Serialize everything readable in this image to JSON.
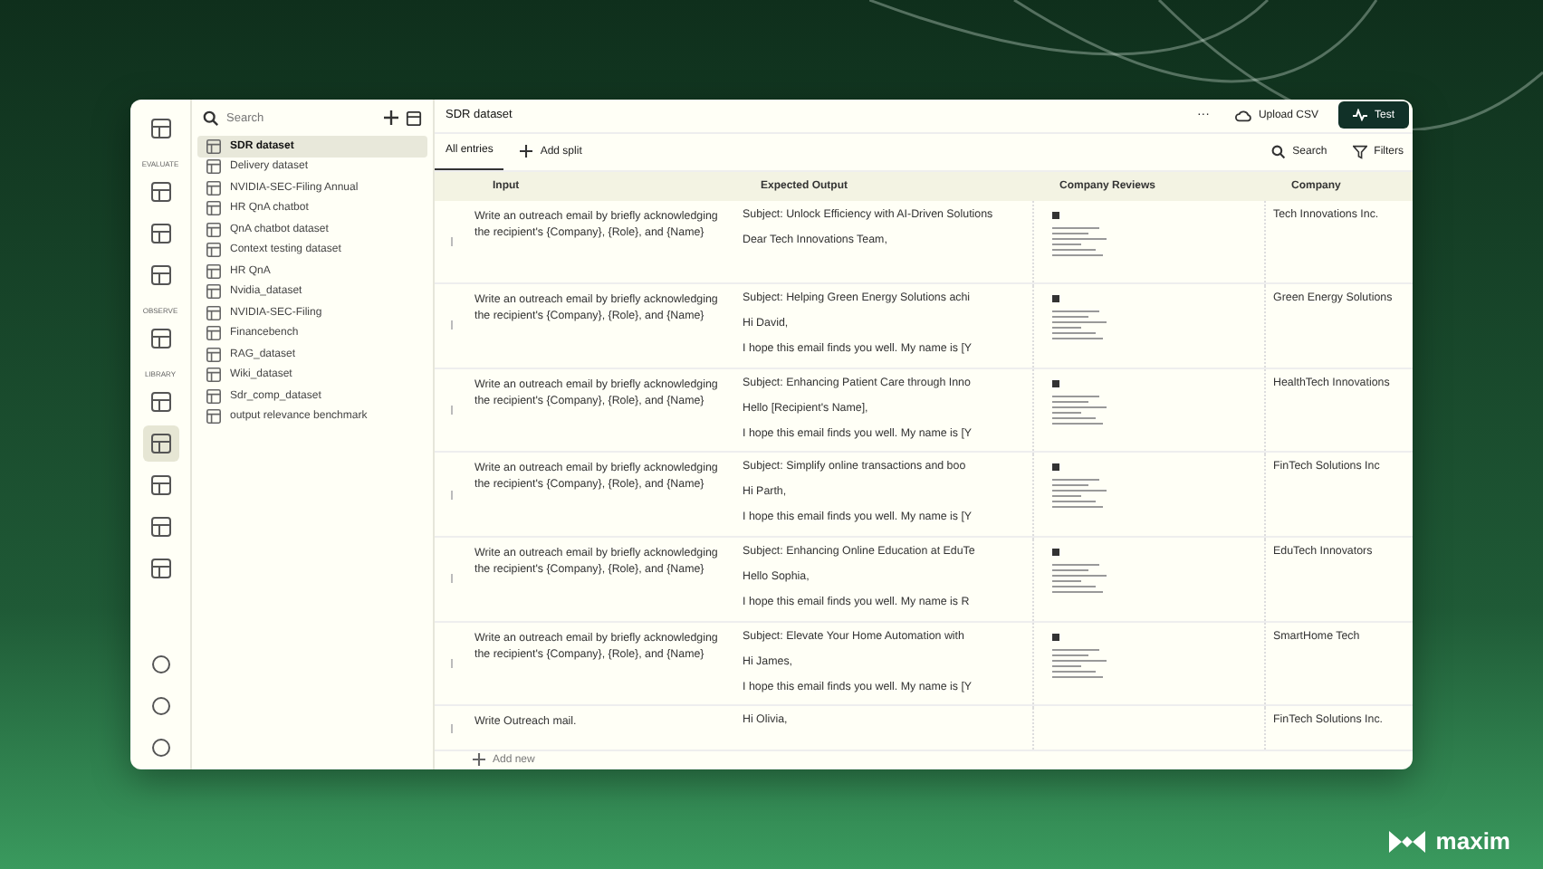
{
  "rail": [
    {
      "kind": "icon",
      "selected": false
    },
    {
      "kind": "label",
      "text": "EVALUATE"
    },
    {
      "kind": "icon",
      "selected": false
    },
    {
      "kind": "icon",
      "selected": false
    },
    {
      "kind": "icon",
      "selected": false
    },
    {
      "kind": "label",
      "text": "OBSERVE"
    },
    {
      "kind": "icon",
      "selected": false
    },
    {
      "kind": "label",
      "text": "LIBRARY"
    },
    {
      "kind": "icon",
      "selected": false
    },
    {
      "kind": "icon",
      "selected": true
    },
    {
      "kind": "icon",
      "selected": false
    },
    {
      "kind": "icon",
      "selected": false
    },
    {
      "kind": "icon",
      "selected": false
    }
  ],
  "rail_bottom": [
    {
      "kind": "icon",
      "selected": false
    },
    {
      "kind": "icon",
      "selected": false
    },
    {
      "kind": "icon",
      "selected": false
    }
  ],
  "sidebar": {
    "search": {
      "placeholder": "Search"
    },
    "items": [
      {
        "label": "SDR dataset",
        "selected": true
      },
      {
        "label": "Delivery dataset",
        "selected": false
      },
      {
        "label": "NVIDIA-SEC-Filing Annual",
        "selected": false
      },
      {
        "label": "HR QnA chatbot",
        "selected": false
      },
      {
        "label": "QnA chatbot dataset",
        "selected": false
      },
      {
        "label": "Context testing dataset",
        "selected": false
      },
      {
        "label": "HR QnA",
        "selected": false
      },
      {
        "label": "Nvidia_dataset",
        "selected": false
      },
      {
        "label": "NVIDIA-SEC-Filing",
        "selected": false
      },
      {
        "label": "Financebench",
        "selected": false
      },
      {
        "label": "RAG_dataset",
        "selected": false
      },
      {
        "label": "Wiki_dataset",
        "selected": false
      },
      {
        "label": "Sdr_comp_dataset",
        "selected": false
      },
      {
        "label": "output relevance benchmark",
        "selected": false
      }
    ]
  },
  "main": {
    "title": "SDR dataset",
    "more": "···",
    "upload": "Upload CSV",
    "test": "Test",
    "tabs": [
      {
        "label": "All entries",
        "selected": true
      }
    ],
    "add_split": "Add split",
    "search": "Search",
    "filters": "Filters",
    "columns": [
      "Input",
      "Expected Output",
      "Company Reviews",
      "Company"
    ],
    "rows": [
      {
        "input": "Write an outreach email by briefly acknowledging the recipient's {Company}, {Role}, and {Name}",
        "expected_output": [
          "Subject: Unlock Efficiency with AI-Driven Solutions",
          "Dear Tech Innovations Team,"
        ],
        "company": "Tech Innovations Inc.",
        "has_review": true
      },
      {
        "input": "Write an outreach email by briefly acknowledging the recipient's {Company}, {Role}, and {Name}",
        "expected_output": [
          "Subject: Helping Green Energy Solutions achi",
          "Hi David,",
          "I hope this email finds you well. My name is [Y"
        ],
        "company": "Green Energy Solutions",
        "has_review": true
      },
      {
        "input": "Write an outreach email by briefly acknowledging the recipient's {Company}, {Role}, and {Name}",
        "expected_output": [
          "Subject: Enhancing Patient Care through Inno",
          "Hello [Recipient's Name],",
          "I hope this email finds you well. My name is [Y"
        ],
        "company": "HealthTech Innovations",
        "has_review": true
      },
      {
        "input": "Write an outreach email by briefly acknowledging the recipient's {Company}, {Role}, and {Name}",
        "expected_output": [
          "Subject: Simplify online transactions and boo",
          "Hi Parth,",
          "I hope this email finds you well. My name is [Y"
        ],
        "company": "FinTech Solutions Inc",
        "has_review": true
      },
      {
        "input": "Write an outreach email by briefly acknowledging the recipient's {Company}, {Role}, and {Name}",
        "expected_output": [
          "Subject: Enhancing Online Education at EduTe",
          "Hello Sophia,",
          "I hope this email finds you well. My name is R"
        ],
        "company": "EduTech Innovators",
        "has_review": true
      },
      {
        "input": "Write an outreach email by briefly acknowledging the recipient's {Company}, {Role}, and {Name}",
        "expected_output": [
          "Subject: Elevate Your Home Automation with",
          "Hi James,",
          "I hope this email finds you well. My name is [Y"
        ],
        "company": "SmartHome Tech",
        "has_review": true
      },
      {
        "input": "Write Outreach mail.",
        "expected_output": [
          "Hi Olivia,"
        ],
        "company": "FinTech Solutions Inc.",
        "has_review": false
      }
    ],
    "add_new": "Add new"
  },
  "brand": "maxim"
}
